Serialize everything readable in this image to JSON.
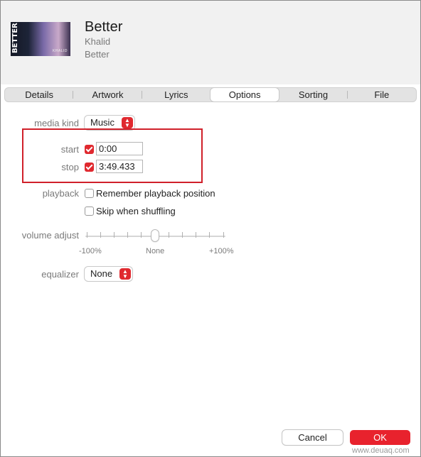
{
  "header": {
    "title": "Better",
    "artist": "Khalid",
    "album": "Better",
    "artwork_text": "BETTER",
    "artwork_subtext": "KHALID"
  },
  "tabs": [
    {
      "label": "Details",
      "active": false
    },
    {
      "label": "Artwork",
      "active": false
    },
    {
      "label": "Lyrics",
      "active": false
    },
    {
      "label": "Options",
      "active": true
    },
    {
      "label": "Sorting",
      "active": false
    },
    {
      "label": "File",
      "active": false
    }
  ],
  "options": {
    "media_kind_label": "media kind",
    "media_kind_value": "Music",
    "start_label": "start",
    "start_checked": true,
    "start_value": "0:00",
    "stop_label": "stop",
    "stop_checked": true,
    "stop_value": "3:49.433",
    "playback_label": "playback",
    "remember_label": "Remember playback position",
    "remember_checked": false,
    "skip_label": "Skip when shuffling",
    "skip_checked": false,
    "volume_label": "volume adjust",
    "volume_min_label": "-100%",
    "volume_mid_label": "None",
    "volume_max_label": "+100%",
    "volume_value_percent": 0,
    "equalizer_label": "equalizer",
    "equalizer_value": "None"
  },
  "buttons": {
    "cancel": "Cancel",
    "ok": "OK"
  },
  "watermark": "www.deuaq.com",
  "colors": {
    "accent": "#e0292f",
    "highlight_box": "#d0202a"
  }
}
